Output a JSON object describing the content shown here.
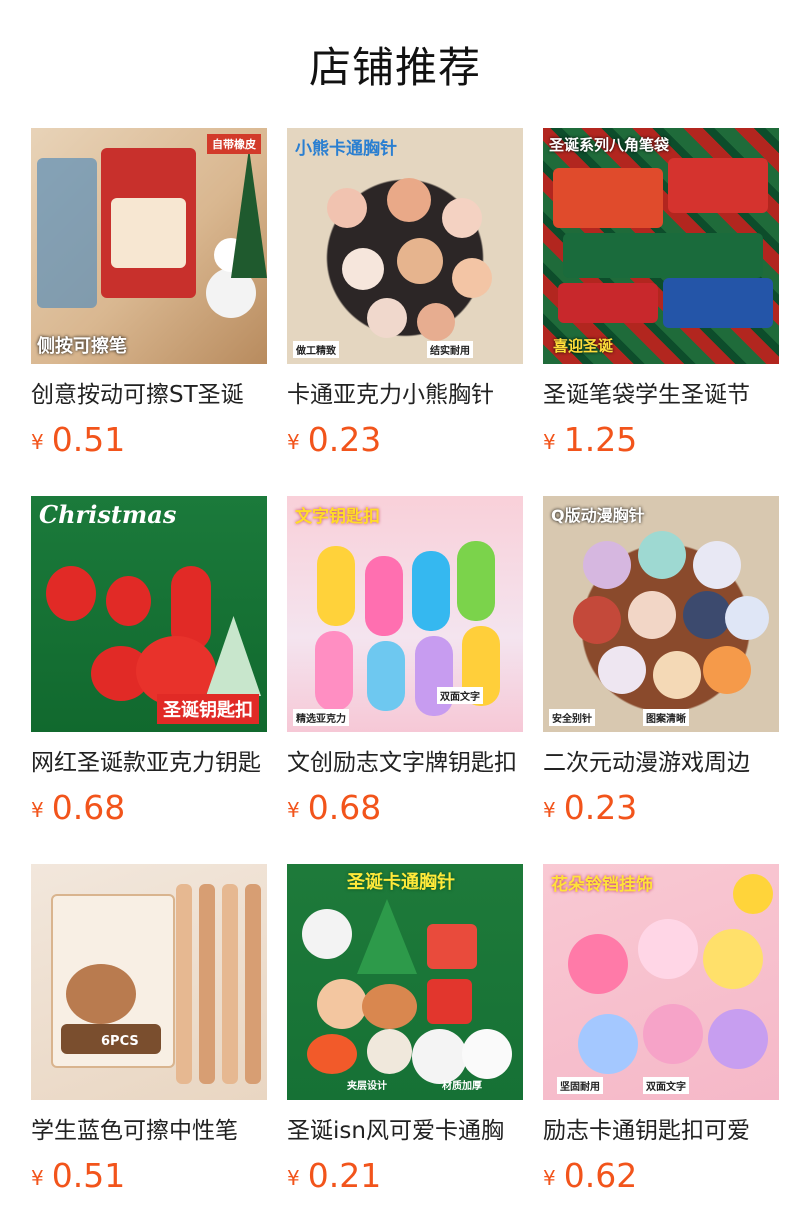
{
  "header": {
    "title": "店铺推荐"
  },
  "currency_symbol": "¥",
  "products": [
    {
      "title": "创意按动可擦ST圣诞",
      "price": "0.51",
      "image_text": [
        "自带橡皮",
        "侧按可擦笔"
      ]
    },
    {
      "title": "卡通亚克力小熊胸针",
      "price": "0.23",
      "image_text": [
        "小熊卡通胸针",
        "做工精致",
        "结实耐用"
      ]
    },
    {
      "title": "圣诞笔袋学生圣诞节",
      "price": "1.25",
      "image_text": [
        "圣诞系列八角笔袋",
        "喜迎圣诞"
      ]
    },
    {
      "title": "网红圣诞款亚克力钥匙",
      "price": "0.68",
      "image_text": [
        "Christmas",
        "圣诞钥匙扣"
      ]
    },
    {
      "title": "文创励志文字牌钥匙扣",
      "price": "0.68",
      "image_text": [
        "文字钥匙扣",
        "精选亚克力",
        "双面文字"
      ]
    },
    {
      "title": "二次元动漫游戏周边",
      "price": "0.23",
      "image_text": [
        "Q版动漫胸针",
        "安全别针",
        "图案清晰"
      ]
    },
    {
      "title": "学生蓝色可擦中性笔",
      "price": "0.51",
      "image_text": [
        "6PCS"
      ]
    },
    {
      "title": "圣诞isn风可爱卡通胸",
      "price": "0.21",
      "image_text": [
        "圣诞卡通胸针",
        "夹层设计",
        "材质加厚"
      ]
    },
    {
      "title": "励志卡通钥匙扣可爱",
      "price": "0.62",
      "image_text": [
        "花朵铃铛挂饰",
        "坚固耐用",
        "双面文字"
      ]
    }
  ]
}
